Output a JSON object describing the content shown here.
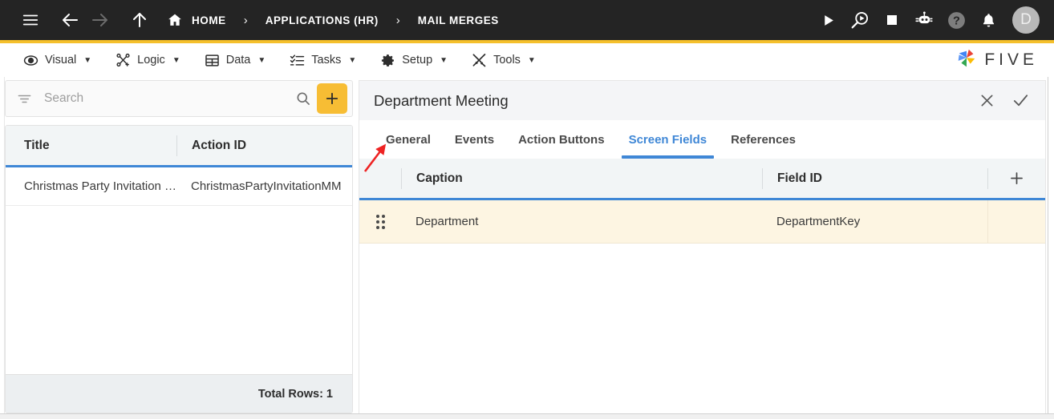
{
  "topnav": {
    "menu_icon": "hamburger-icon",
    "back_icon": "arrow-left-icon",
    "forward_icon": "arrow-right-icon",
    "up_icon": "arrow-up-icon",
    "home_icon": "home-icon",
    "breadcrumbs": [
      {
        "label": "HOME"
      },
      {
        "label": "APPLICATIONS (HR)"
      },
      {
        "label": "MAIL MERGES"
      }
    ],
    "separator": "›",
    "actions": [
      {
        "name": "run-icon",
        "title": "Run"
      },
      {
        "name": "preview-run-icon",
        "title": "Preview"
      },
      {
        "name": "stop-icon",
        "title": "Stop"
      },
      {
        "name": "chatbot-icon",
        "title": "Assistant"
      },
      {
        "name": "help-icon",
        "title": "Help"
      },
      {
        "name": "notifications-bell-icon",
        "title": "Notifications"
      }
    ],
    "avatar_initial": "D",
    "accent_bar_color": "#f5c02c",
    "background_color": "#242424"
  },
  "menubar": {
    "items": [
      {
        "label": "Visual",
        "icon": "eye-icon",
        "caret": "▼"
      },
      {
        "label": "Logic",
        "icon": "logic-nodes-icon",
        "caret": "▼"
      },
      {
        "label": "Data",
        "icon": "data-grid-icon",
        "caret": "▼"
      },
      {
        "label": "Tasks",
        "icon": "tasks-list-icon",
        "caret": "▼"
      },
      {
        "label": "Setup",
        "icon": "gear-icon",
        "caret": "▼"
      },
      {
        "label": "Tools",
        "icon": "tools-icon",
        "caret": "▼"
      }
    ],
    "brand": {
      "text": "FIVE",
      "logo": "five-pinwheel-logo"
    }
  },
  "sidebar": {
    "search": {
      "placeholder": "Search",
      "value": "",
      "filter_icon": "filter-icon",
      "search_icon": "search-icon"
    },
    "add_button": {
      "label": "+",
      "color": "#f7bd34"
    },
    "grid": {
      "columns": [
        "Title",
        "Action ID"
      ],
      "rows": [
        {
          "title": "Christmas Party Invitation …",
          "action_id": "ChristmasPartyInvitationMM"
        }
      ],
      "footer": "Total Rows: 1",
      "header_accent_color": "#3f87d6"
    }
  },
  "detail": {
    "title": "Department Meeting",
    "close_label": "✕",
    "confirm_label": "✓",
    "tabs": [
      {
        "label": "General",
        "active": false
      },
      {
        "label": "Events",
        "active": false
      },
      {
        "label": "Action Buttons",
        "active": false
      },
      {
        "label": "Screen Fields",
        "active": true
      },
      {
        "label": "References",
        "active": false
      }
    ],
    "active_tab_color": "#3f87d6",
    "fields_table": {
      "columns": [
        "Caption",
        "Field ID"
      ],
      "add_label": "+",
      "rows": [
        {
          "caption": "Department",
          "field_id": "DepartmentKey",
          "handle": "drag-handle-icon",
          "highlight_color": "#fdf5e2"
        }
      ]
    }
  },
  "annotation": {
    "arrow_color": "#ee2222",
    "points_to": "General"
  }
}
